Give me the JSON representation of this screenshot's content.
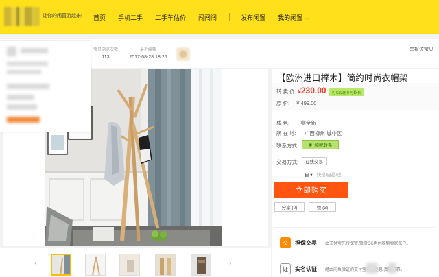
{
  "header": {
    "slogan": "让你的闲置游起来!",
    "nav": [
      {
        "label": "首页"
      },
      {
        "label": "手机二手"
      },
      {
        "label": "二手车估价"
      },
      {
        "label": "闯闯闯"
      },
      {
        "label": "发布闲置"
      },
      {
        "label": "我的闲置"
      }
    ]
  },
  "info": {
    "views_label": "宝贝浏览次数",
    "views_value": "113",
    "date_label": "最近编辑",
    "date_value": "2017-08-28 18:25",
    "report": "举报该宝贝"
  },
  "product": {
    "title": "【欧洲进口榉木】简约时尚衣帽架",
    "price_label": "转 卖 价:",
    "currency": "¥",
    "price": "230.00",
    "price_badge": "可以议价/可砍价",
    "orig_label": "原      价:",
    "orig_price": "¥ 499.00",
    "condition_label": "成      色:",
    "condition": "非全新",
    "location_label": "所 在 地:",
    "location": "广西柳州 城中区",
    "contact_label": "联系方式:",
    "contact_btn": "和我联系",
    "trade_label": "交易方式:",
    "trade_value": "在线交易",
    "pick_prefix": "自",
    "pick_hint": "快递/自提/送",
    "buy_label": "立即购买",
    "share_label": "分享 (0)",
    "like_label": "赞 (3)"
  },
  "guarantee": {
    "escrow_icon": "交",
    "escrow_title": "担保交易",
    "escrow_desc": "由支付宝先行保管,验货OK再付款到卖家账户。",
    "real_icon": "证",
    "real_title": "实名认证",
    "real_desc": "经由闲鱼验证的支付宝实名信息,真实可靠。"
  },
  "colors": {
    "brand_yellow": "#ffe01a",
    "price_red": "#ef3b24",
    "buy_orange": "#ff5511",
    "contact_green": "#b8e26e"
  }
}
